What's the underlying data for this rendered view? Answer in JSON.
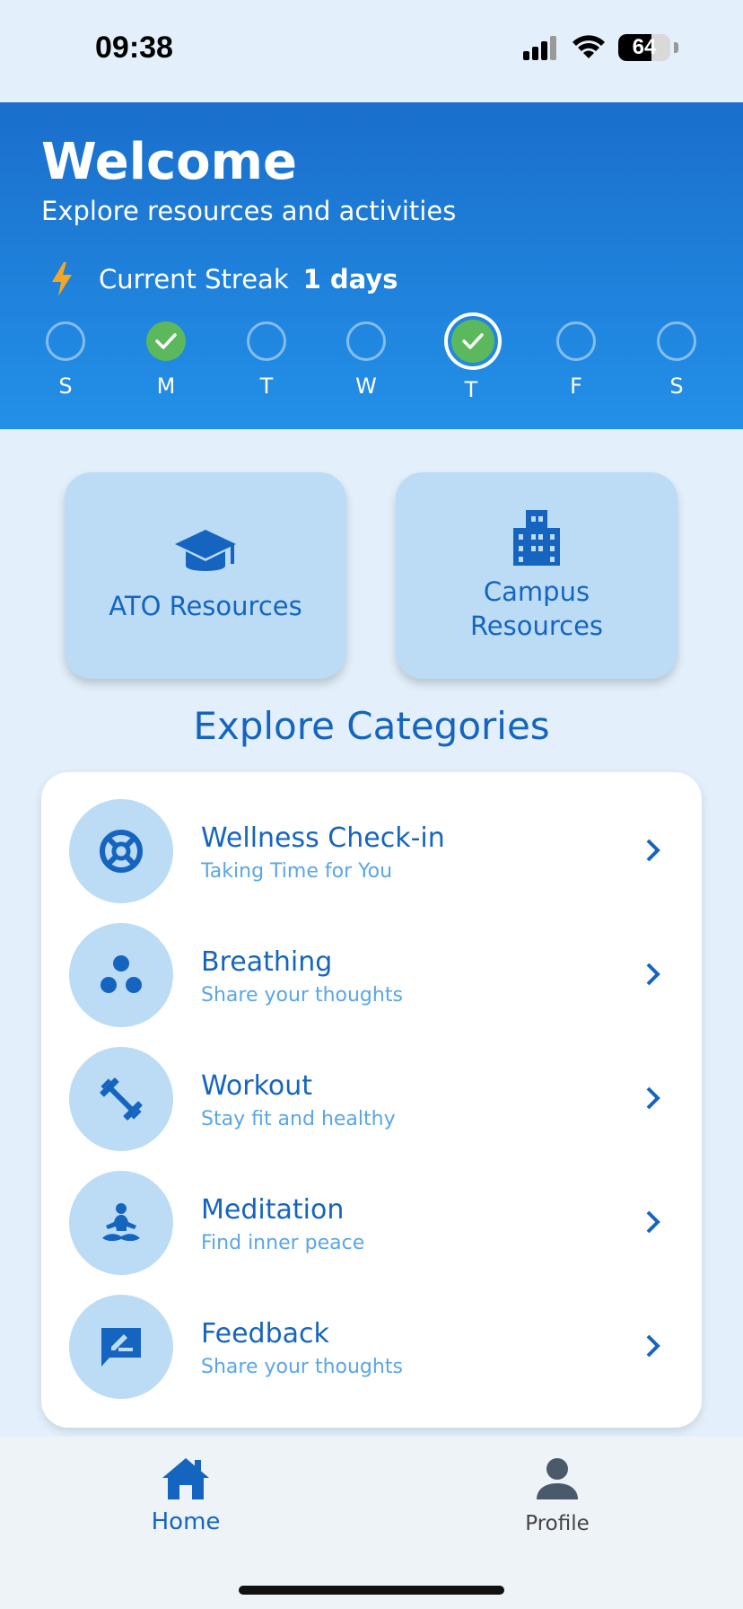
{
  "status_bar": {
    "time": "09:38",
    "battery": "64",
    "battery_level": 64
  },
  "header": {
    "title": "Welcome",
    "subtitle": "Explore resources and activities",
    "streak_label": "Current Streak",
    "streak_value": "1 days",
    "days": [
      {
        "label": "S",
        "completed": false,
        "today": false
      },
      {
        "label": "M",
        "completed": true,
        "today": false
      },
      {
        "label": "T",
        "completed": false,
        "today": false
      },
      {
        "label": "W",
        "completed": false,
        "today": false
      },
      {
        "label": "T",
        "completed": true,
        "today": true
      },
      {
        "label": "F",
        "completed": false,
        "today": false
      },
      {
        "label": "S",
        "completed": false,
        "today": false
      }
    ]
  },
  "resources": [
    {
      "label": "ATO Resources",
      "icon": "graduation-cap-icon"
    },
    {
      "label": "Campus\nResources",
      "icon": "building-icon"
    }
  ],
  "section_title": "Explore Categories",
  "categories": [
    {
      "title": "Wellness Check-in",
      "subtitle": "Taking Time for You",
      "icon": "life-ring-icon"
    },
    {
      "title": "Breathing",
      "subtitle": "Share your thoughts",
      "icon": "three-dots-icon"
    },
    {
      "title": "Workout",
      "subtitle": "Stay fit and healthy",
      "icon": "dumbbell-icon"
    },
    {
      "title": "Meditation",
      "subtitle": "Find inner peace",
      "icon": "meditation-icon"
    },
    {
      "title": "Feedback",
      "subtitle": "Share your thoughts",
      "icon": "feedback-icon"
    }
  ],
  "nav": {
    "home_label": "Home",
    "profile_label": "Profile"
  },
  "colors": {
    "accent": "#1565c0",
    "header_start": "#1a6fcb",
    "header_end": "#2390e8",
    "card_bg": "#bcdcf6",
    "check_green": "#5cb85c",
    "bolt": "#f5a623"
  }
}
